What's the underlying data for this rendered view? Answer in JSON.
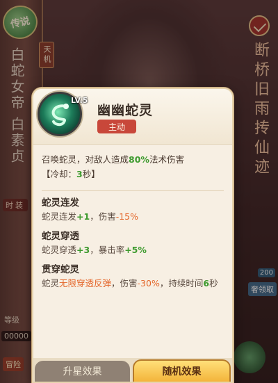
{
  "background": {
    "badge": "传说",
    "hero_title": "白蛇女帝",
    "hero_name": "白素贞",
    "tag": "天机",
    "poem": "断桥旧雨抟仙迹",
    "time_label": "时装",
    "equip_label": "等级",
    "gold_value": "00000",
    "adventure_label": "冒险",
    "reward_count": "200",
    "claim_label": "奢领取"
  },
  "skill": {
    "level": "LV.5",
    "name": "幽幽蛇灵",
    "type": "主动",
    "description": {
      "prefix": "召唤蛇灵，对敌人造成",
      "damage": "80%",
      "suffix": "法术伤害"
    },
    "cooldown": {
      "open": "【冷却：",
      "value": "3",
      "close": "秒】"
    },
    "effects": [
      {
        "title": "蛇灵连发",
        "parts": [
          {
            "text": "蛇灵连发",
            "color": "normal"
          },
          {
            "text": "+1",
            "color": "green"
          },
          {
            "text": "，伤害",
            "color": "normal"
          },
          {
            "text": "-15%",
            "color": "orange"
          }
        ]
      },
      {
        "title": "蛇灵穿透",
        "parts": [
          {
            "text": "蛇灵穿透",
            "color": "normal"
          },
          {
            "text": "+3",
            "color": "green"
          },
          {
            "text": "，暴击率",
            "color": "normal"
          },
          {
            "text": "+5%",
            "color": "green"
          }
        ]
      },
      {
        "title": "贯穿蛇灵",
        "parts": [
          {
            "text": "蛇灵",
            "color": "normal"
          },
          {
            "text": "无限穿透反弹",
            "color": "orange"
          },
          {
            "text": "，伤害",
            "color": "normal"
          },
          {
            "text": "-30%",
            "color": "orange"
          },
          {
            "text": "，持续时间",
            "color": "normal"
          },
          {
            "text": "6",
            "color": "green"
          },
          {
            "text": "秒",
            "color": "normal"
          }
        ]
      }
    ]
  },
  "tabs": [
    {
      "label": "升星效果",
      "active": false
    },
    {
      "label": "随机效果",
      "active": true
    }
  ],
  "colors": {
    "green": "#3d9a2e",
    "orange": "#e4662a",
    "type_badge": "#c8473a",
    "active_tab": "#f3b43a"
  }
}
